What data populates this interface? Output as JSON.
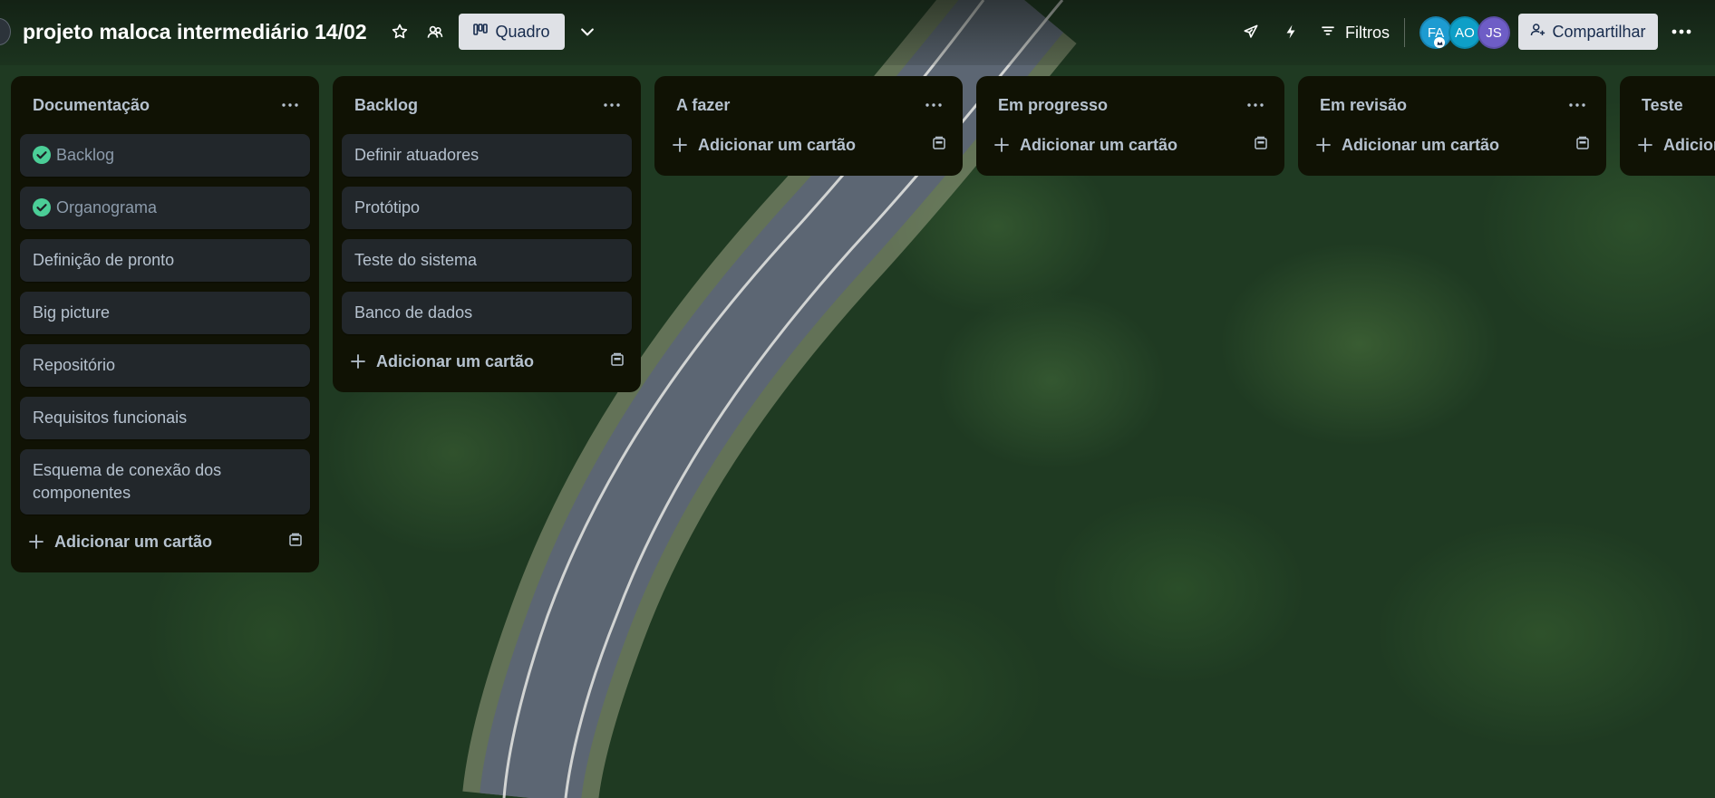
{
  "board": {
    "title": "projeto maloca intermediário 14/02",
    "view_label": "Quadro",
    "filters_label": "Filtros",
    "share_label": "Compartilhar"
  },
  "members": [
    {
      "initials": "FA",
      "color": "#1d9bd1"
    },
    {
      "initials": "AO",
      "color": "#0e9fc7"
    },
    {
      "initials": "JS",
      "color": "#6e5dc6"
    }
  ],
  "lists": [
    {
      "title": "Documentação",
      "cards": [
        {
          "text": "Backlog",
          "done": true
        },
        {
          "text": "Organograma",
          "done": true
        },
        {
          "text": "Definição de pronto"
        },
        {
          "text": "Big picture"
        },
        {
          "text": "Repositório"
        },
        {
          "text": "Requisitos funcionais"
        },
        {
          "text": "Esquema de conexão dos componentes"
        }
      ],
      "add_label": "Adicionar um cartão"
    },
    {
      "title": "Backlog",
      "cards": [
        {
          "text": "Definir atuadores"
        },
        {
          "text": "Protótipo"
        },
        {
          "text": "Teste do sistema"
        },
        {
          "text": "Banco de dados"
        }
      ],
      "add_label": "Adicionar um cartão"
    },
    {
      "title": "A fazer",
      "cards": [],
      "add_label": "Adicionar um cartão"
    },
    {
      "title": "Em progresso",
      "cards": [],
      "add_label": "Adicionar um cartão"
    },
    {
      "title": "Em revisão",
      "cards": [],
      "add_label": "Adicionar um cartão"
    },
    {
      "title": "Teste",
      "cards": [],
      "add_label": "Adicionar um cartão"
    }
  ],
  "colors": {
    "list_bg": "#101204",
    "card_bg": "#22272b",
    "done_check": "#4bce97",
    "button_bg": "#dfe1e6"
  }
}
